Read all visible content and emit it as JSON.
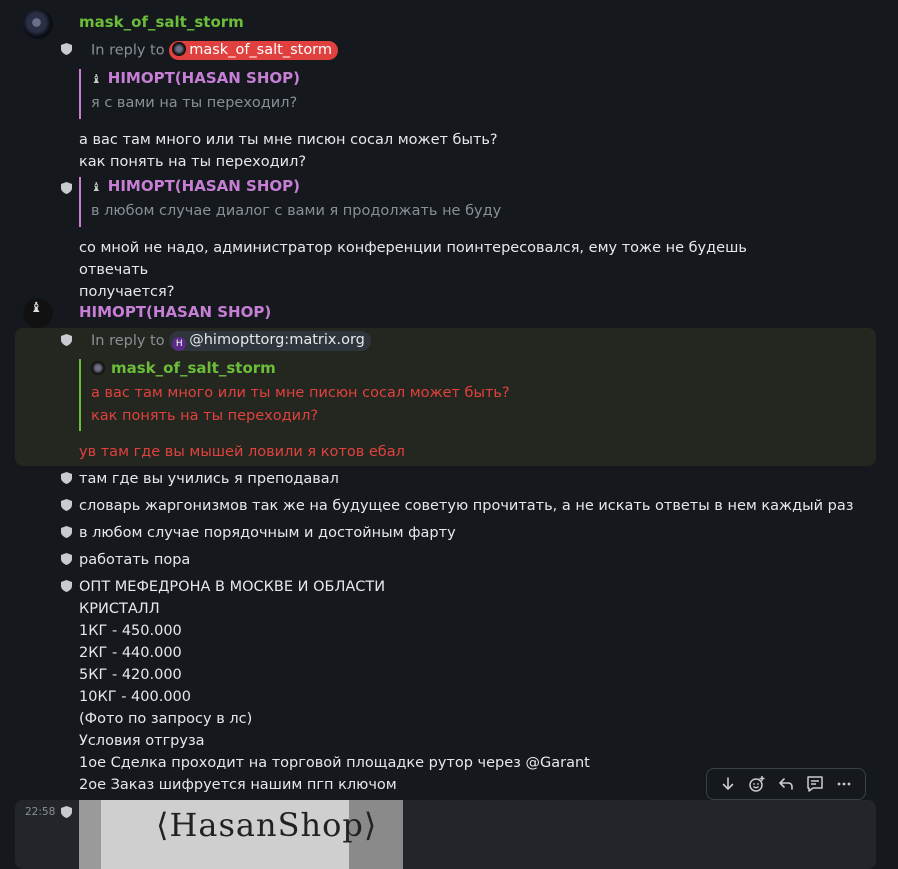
{
  "msg1": {
    "sender": "mask_of_salt_storm",
    "reply_prefix": "In reply to",
    "reply_pill": "mask_of_salt_storm",
    "quote_sender": "HIMOPT(HASAN SHOP)",
    "quote_text": "я с вами на ты переходил?",
    "body1": "а вас там много или ты мне писюн сосал может быть?\nкак понять на ты переходил?",
    "quote2_sender": "HIMOPT(HASAN SHOP)",
    "quote2_text": "в любом случае диалог с вами я продолжать не буду",
    "body2": "со мной не надо, администратор конференции поинтересовался, ему тоже не будешь отвечать\nполучается?"
  },
  "msg2": {
    "sender": "HIMOPT(HASAN SHOP)",
    "reply_prefix": "In reply to",
    "reply_pill_initial": "H",
    "reply_pill": "@himopttorg:matrix.org",
    "quote_sender": "mask_of_salt_storm",
    "quote_text": "а вас там много или ты мне писюн сосал может быть?\nкак понять на ты переходил?",
    "body": "ув там где вы мышей ловили я котов ебал",
    "lines": [
      "там где вы учились я преподавал",
      "словарь жаргонизмов так же на будущее советую прочитать, а не искать ответы в нем каждый раз",
      "в любом случае порядочным и достойным фарту",
      "работать пора"
    ],
    "ad": "ОПТ МЕФЕДРОНА В МОСКВЕ И ОБЛАСТИ\nКРИСТАЛЛ\n1КГ - 450.000\n2КГ - 440.000\n5КГ - 420.000\n10КГ - 400.000\n(Фото по запросу в лс)\nУсловия отгруза\n1ое Сделка проходит на торговой площадке рутор через @Garant\n2ое Заказ шифруется нашим пгп ключом",
    "timestamp": "22:58",
    "image_text": "⟨HasanShop⟩"
  },
  "toolbar": {
    "icons": [
      "arrow-down-icon",
      "add-reaction-icon",
      "reply-icon",
      "thread-icon",
      "more-options-icon"
    ]
  },
  "colors": {
    "background": "#15191e",
    "green_name": "#6bbd3a",
    "purple_name": "#c77fd6",
    "highlight_red": "#e0413e",
    "highlight_bg": "#242720"
  }
}
